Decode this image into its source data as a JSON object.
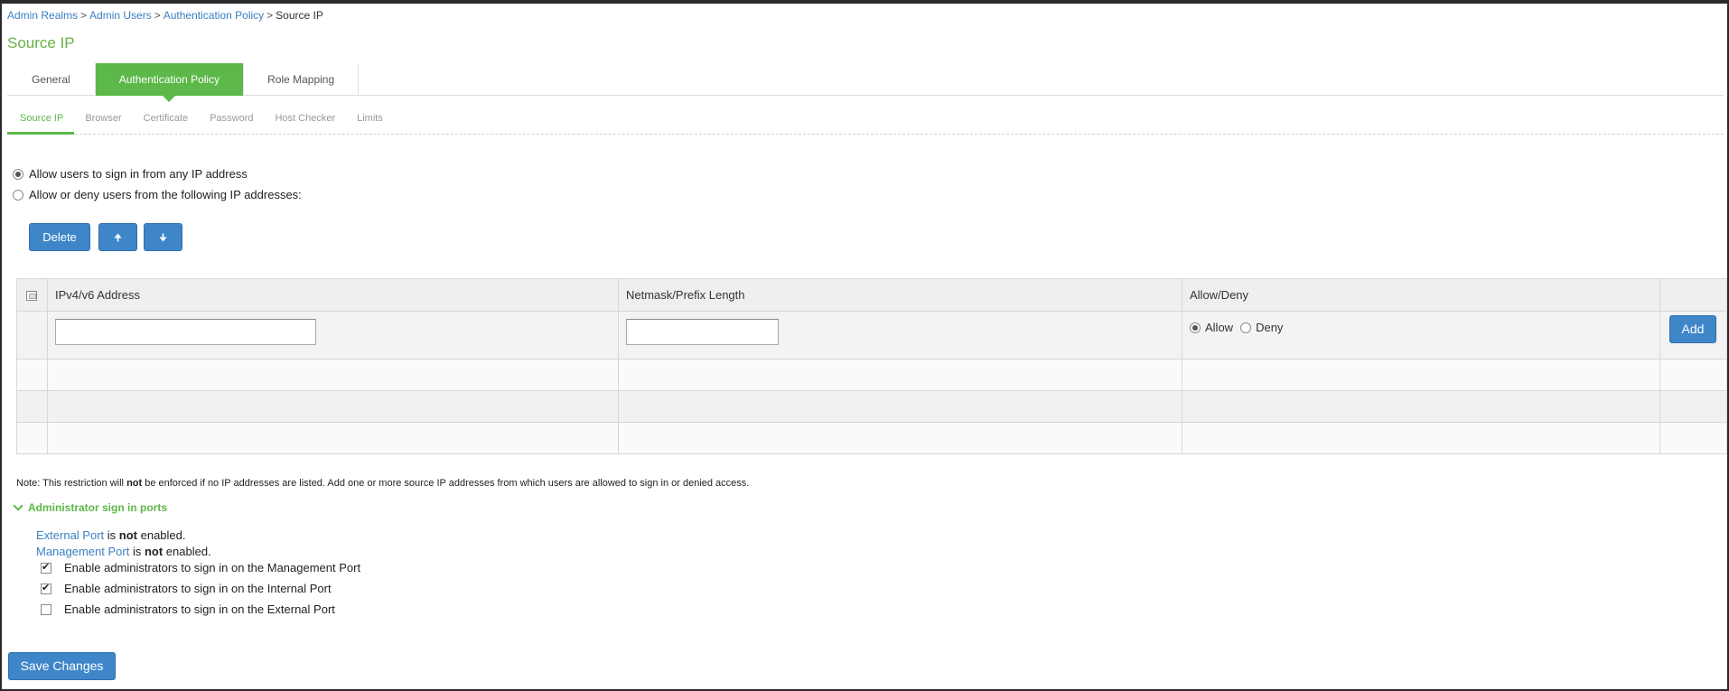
{
  "breadcrumb": {
    "items": [
      "Admin Realms",
      "Admin Users",
      "Authentication Policy"
    ],
    "current": "Source IP",
    "separator": ">"
  },
  "page_title": "Source IP",
  "tabs": [
    {
      "label": "General",
      "active": false
    },
    {
      "label": "Authentication Policy",
      "active": true
    },
    {
      "label": "Role Mapping",
      "active": false
    }
  ],
  "subtabs": [
    {
      "label": "Source IP",
      "active": true
    },
    {
      "label": "Browser",
      "active": false
    },
    {
      "label": "Certificate",
      "active": false
    },
    {
      "label": "Password",
      "active": false
    },
    {
      "label": "Host Checker",
      "active": false
    },
    {
      "label": "Limits",
      "active": false
    }
  ],
  "access_mode": {
    "options": [
      {
        "label": "Allow users to sign in from any IP address",
        "checked": true
      },
      {
        "label": "Allow or deny users from the following IP addresses:",
        "checked": false
      }
    ]
  },
  "toolbar": {
    "delete_label": "Delete",
    "move_up_glyph": "🠉",
    "move_down_glyph": "🠋"
  },
  "table": {
    "columns": [
      "IPv4/v6 Address",
      "Netmask/Prefix Length",
      "Allow/Deny"
    ],
    "input_row": {
      "ip_value": "",
      "netmask_value": "",
      "allow_label": "Allow",
      "deny_label": "Deny",
      "allow_selected": true,
      "add_label": "Add"
    }
  },
  "note": {
    "prefix": "Note: This restriction will ",
    "emphasis": "not",
    "suffix": " be enforced if no IP addresses are listed. Add one or more source IP addresses from which users are allowed to sign in or denied access."
  },
  "admin_ports": {
    "heading": "Administrator sign in ports",
    "status": [
      {
        "link": "External Port",
        "pre": " is ",
        "bold": "not",
        "post": " enabled."
      },
      {
        "link": "Management Port",
        "pre": " is ",
        "bold": "not",
        "post": " enabled."
      }
    ],
    "options": [
      {
        "label": "Enable administrators to sign in on the Management Port",
        "checked": true
      },
      {
        "label": "Enable administrators to sign in on the Internal Port",
        "checked": true
      },
      {
        "label": "Enable administrators to sign in on the External Port",
        "checked": false
      }
    ]
  },
  "save_label": "Save Changes",
  "colors": {
    "accent_green": "#5cb848",
    "link_blue": "#3a7fc1",
    "button_blue": "#3f86c9"
  }
}
